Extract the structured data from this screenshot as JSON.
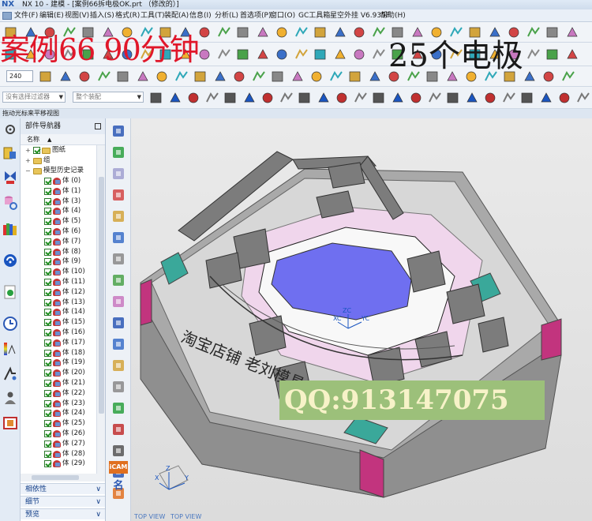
{
  "window": {
    "logo": "NX",
    "title": "NX 10 - 建模 - [案例66拆电极OK.prt （修改的）]"
  },
  "menu": {
    "items": [
      "文件(F)",
      "编辑(E)",
      "视图(V)",
      "插入(S)",
      "格式(R)",
      "工具(T)",
      "装配(A)",
      "信息(I)",
      "分析(L)",
      "首选项(P)",
      "窗口(O)",
      "GC工具箱",
      "星空外挂 V6.935F",
      "帮助(H)"
    ]
  },
  "overlay": {
    "headline": "案例66  90分钟",
    "count": "25个电极"
  },
  "toolbar": {
    "zoom_value": "240",
    "selection_filter": "没有选择过滤器",
    "assembly_scope": "整个装配"
  },
  "status": {
    "hint": "拖动光标来平移视图"
  },
  "navigator": {
    "title": "部件导航器",
    "column_name": "名称",
    "sort_indicator": "▲",
    "top_nodes": [
      {
        "label": "图纸",
        "expander": "+"
      },
      {
        "label": "组",
        "expander": "+"
      },
      {
        "label": "模型历史记录",
        "expander": "−"
      }
    ],
    "bodies": [
      "体 (0)",
      "体 (1)",
      "体 (3)",
      "体 (4)",
      "体 (5)",
      "体 (6)",
      "体 (7)",
      "体 (8)",
      "体 (9)",
      "体 (10)",
      "体 (11)",
      "体 (12)",
      "体 (13)",
      "体 (14)",
      "体 (15)",
      "体 (16)",
      "体 (17)",
      "体 (18)",
      "体 (19)",
      "体 (20)",
      "体 (21)",
      "体 (22)",
      "体 (23)",
      "体 (24)",
      "体 (25)",
      "体 (26)",
      "体 (27)",
      "体 (28)",
      "体 (29)"
    ],
    "panels": [
      "相依性",
      "细节",
      "预览"
    ]
  },
  "viewport": {
    "watermark": "淘宝店铺  老刘模具工作室",
    "qq": "QQ:913147075",
    "view_labels": [
      "TOP VIEW",
      "TOP VIEW"
    ],
    "axis_labels": {
      "x": "X",
      "y": "Y",
      "z": "Z",
      "zc": "ZC",
      "yc": "YC",
      "xc": "XC"
    }
  },
  "tool_strip": {
    "icam_label": "iCAM",
    "name_glyph": "名"
  },
  "colors": {
    "accent_red": "#e0172a",
    "nav_blue": "#123e88",
    "model_gray": "#a8a8a8",
    "model_blue": "#6f6ff0",
    "model_pink": "#e8c8e8",
    "model_teal": "#3aa89a",
    "model_magenta": "#c2347e",
    "qq_green": "#9cc07a"
  }
}
